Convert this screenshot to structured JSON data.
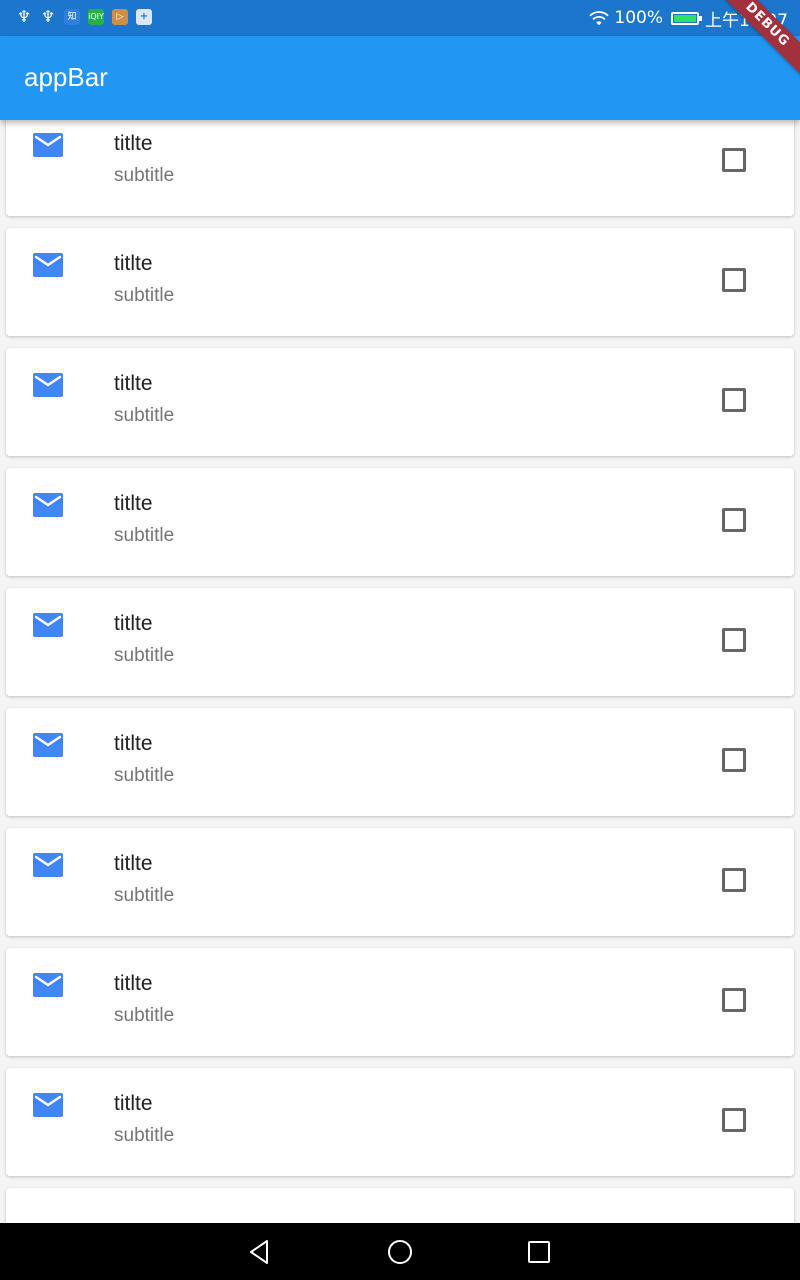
{
  "status_bar": {
    "icons_left": [
      "usb-icon",
      "usb-icon",
      "zhihu-icon",
      "iqiyi-icon",
      "play-icon",
      "plus-icon"
    ],
    "zhihu_glyph": "知",
    "iqiyi_glyph": "iQIY",
    "battery_text": "100%",
    "time": "上午10:07",
    "battery_color": "#2fe066"
  },
  "debug_banner": "DEBUG",
  "app_bar": {
    "title": "appBar",
    "color": "#2196f3"
  },
  "list": {
    "items": [
      {
        "title": "titlte",
        "subtitle": "subtitle",
        "checked": false
      },
      {
        "title": "titlte",
        "subtitle": "subtitle",
        "checked": false
      },
      {
        "title": "titlte",
        "subtitle": "subtitle",
        "checked": false
      },
      {
        "title": "titlte",
        "subtitle": "subtitle",
        "checked": false
      },
      {
        "title": "titlte",
        "subtitle": "subtitle",
        "checked": false
      },
      {
        "title": "titlte",
        "subtitle": "subtitle",
        "checked": false
      },
      {
        "title": "titlte",
        "subtitle": "subtitle",
        "checked": false
      },
      {
        "title": "titlte",
        "subtitle": "subtitle",
        "checked": false
      },
      {
        "title": "titlte",
        "subtitle": "subtitle",
        "checked": false
      }
    ],
    "leading_icon": "mail-icon",
    "icon_color": "#4285f4"
  },
  "nav_bar": {
    "buttons": [
      "back-icon",
      "home-icon",
      "recent-apps-icon"
    ]
  }
}
